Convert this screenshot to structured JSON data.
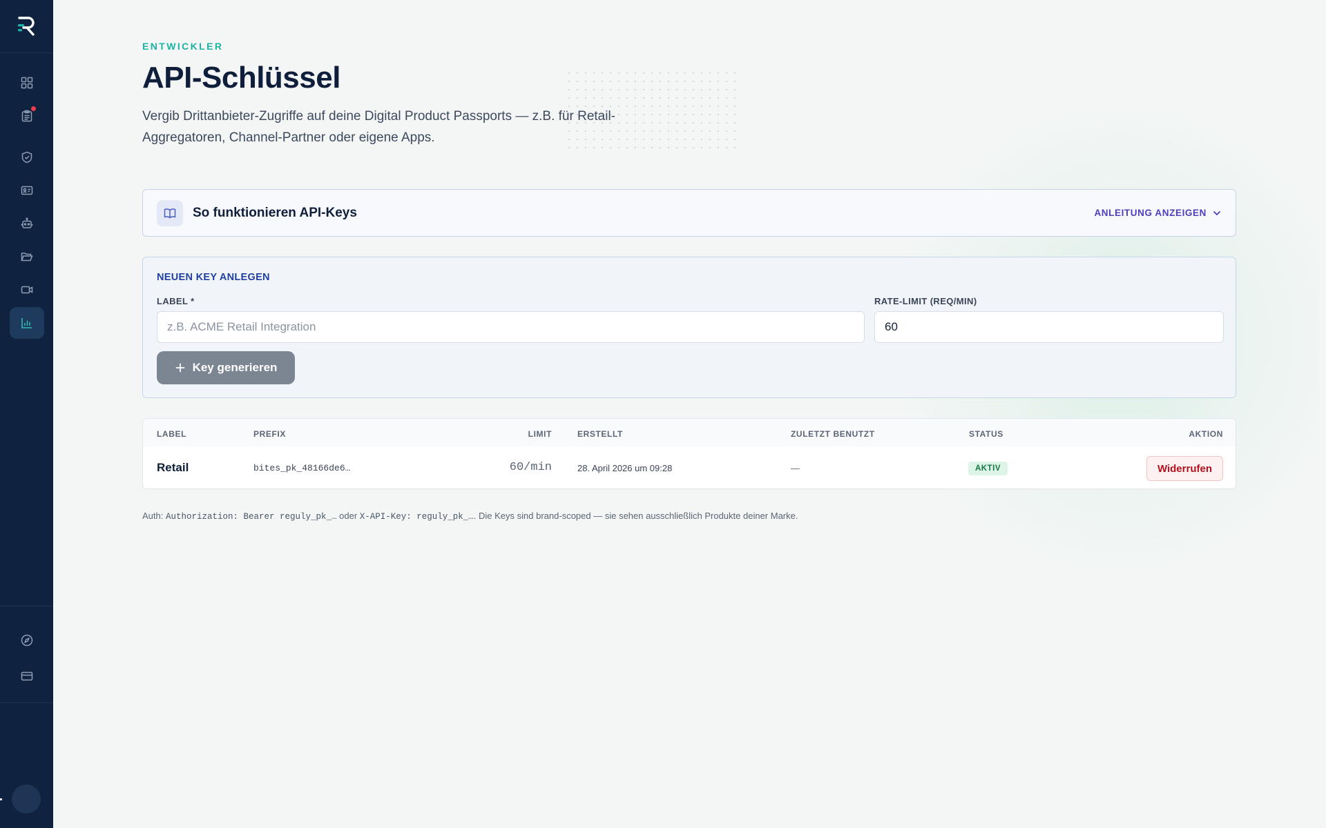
{
  "header": {
    "eyebrow": "ENTWICKLER",
    "title": "API-Schlüssel",
    "description": "Vergib Drittanbieter-Zugriffe auf deine Digital Product Passports — z.B. für Retail-Aggregatoren, Channel-Partner oder eigene Apps."
  },
  "sidebar": {
    "items": [
      {
        "icon": "dashboard-grid-icon",
        "active": false
      },
      {
        "icon": "clipboard-list-icon",
        "active": false,
        "notification": true
      },
      {
        "icon": "shield-check-icon",
        "active": false
      },
      {
        "icon": "id-card-icon",
        "active": false
      },
      {
        "icon": "robot-icon",
        "active": false
      },
      {
        "icon": "folder-open-icon",
        "active": false
      },
      {
        "icon": "video-camera-icon",
        "active": false
      },
      {
        "icon": "bar-chart-icon",
        "active": true
      }
    ],
    "bottom_items": [
      {
        "icon": "compass-icon"
      },
      {
        "icon": "credit-card-icon"
      }
    ]
  },
  "guide": {
    "title": "So funktionieren API-Keys",
    "toggle_label": "ANLEITUNG ANZEIGEN"
  },
  "new_key": {
    "heading": "NEUEN KEY ANLEGEN",
    "label_field": {
      "label": "LABEL *",
      "placeholder": "z.B. ACME Retail Integration",
      "value": ""
    },
    "rate_field": {
      "label": "RATE-LIMIT (REQ/MIN)",
      "value": "60"
    },
    "generate_label": "Key generieren"
  },
  "table": {
    "columns": [
      "LABEL",
      "PREFIX",
      "LIMIT",
      "ERSTELLT",
      "ZULETZT BENUTZT",
      "STATUS",
      "AKTION"
    ],
    "rows": [
      {
        "label": "Retail",
        "prefix": "bites_pk_48166de6…",
        "limit": "60/min",
        "created": "28. April 2026 um 09:28",
        "last_used": "—",
        "status": "AKTIV",
        "action": "Widerrufen"
      }
    ]
  },
  "footnote": {
    "prefix": "Auth: ",
    "code1": "Authorization: Bearer reguly_pk_…",
    "middle": " oder ",
    "code2": "X-API-Key: reguly_pk_…",
    "suffix": ". Die Keys sind brand-scoped — sie sehen ausschließlich Produkte deiner Marke."
  },
  "colors": {
    "sidebar_bg": "#0f2340",
    "accent_teal": "#1ab3a5",
    "heading_blue": "#1f3fa4",
    "toggle_purple": "#4b3fc0",
    "status_green": "#177544",
    "danger_red": "#b3121c"
  }
}
